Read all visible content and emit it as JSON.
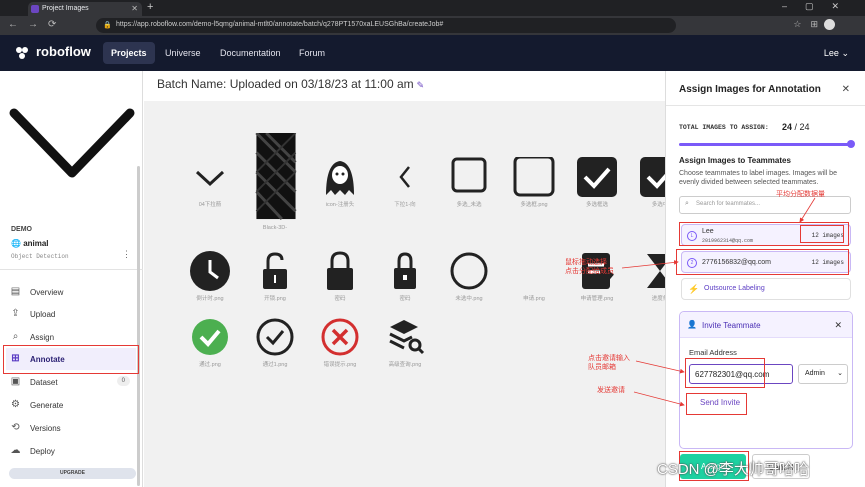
{
  "browser": {
    "tab_title": "Project Images",
    "url": "https://app.roboflow.com/demo-l5qmg/animal-mtlt0/annotate/batch/q278PT1570xaLEUSGhBa/createJob#"
  },
  "topnav": {
    "brand": "roboflow",
    "items": [
      "Projects",
      "Universe",
      "Documentation",
      "Forum"
    ],
    "user": "Lee"
  },
  "sidebar": {
    "workspace": "DEMO",
    "project": "animal",
    "project_type": "Object Detection",
    "menu": [
      {
        "label": "Overview",
        "icon": "overview-icon"
      },
      {
        "label": "Upload",
        "icon": "upload-icon"
      },
      {
        "label": "Assign",
        "icon": "search-icon"
      },
      {
        "label": "Annotate",
        "icon": "annotate-icon"
      },
      {
        "label": "Dataset",
        "icon": "dataset-icon",
        "badge": "0"
      },
      {
        "label": "Generate",
        "icon": "generate-icon"
      },
      {
        "label": "Versions",
        "icon": "versions-icon"
      },
      {
        "label": "Deploy",
        "icon": "deploy-icon"
      }
    ],
    "upgrade": "UPGRADE"
  },
  "main": {
    "batch_name": "Batch Name: Uploaded on 03/18/23 at 11:00 am",
    "images": [
      {
        "caption": "04下拉箭",
        "icon": "chevron-down"
      },
      {
        "caption": "Black-3D-",
        "icon": "dark-texture"
      },
      {
        "caption": "icon-注册头",
        "icon": "ghost"
      },
      {
        "caption": "下拉1-向",
        "icon": "chevron-left"
      },
      {
        "caption": "多选_未选",
        "icon": "square-outline"
      },
      {
        "caption": "多选框.png",
        "icon": "square-outline"
      },
      {
        "caption": "多选框选",
        "icon": "checked-box"
      },
      {
        "caption": "多选中",
        "icon": "checked-box"
      },
      {
        "caption": "倒计时.png",
        "icon": "clock"
      },
      {
        "caption": "开锁.png",
        "icon": "unlock"
      },
      {
        "caption": "密码",
        "icon": "lock"
      },
      {
        "caption": "密码",
        "icon": "lock-key"
      },
      {
        "caption": "未选中.png",
        "icon": "circle-outline"
      },
      {
        "caption": "申请.png",
        "icon": "blank"
      },
      {
        "caption": "申请管理.png",
        "icon": "doc-edit"
      },
      {
        "caption": "进度条",
        "icon": "hourglass"
      },
      {
        "caption": "通过.png",
        "icon": "check-green"
      },
      {
        "caption": "通过1.png",
        "icon": "check-outline"
      },
      {
        "caption": "错误提示.png",
        "icon": "x-red"
      },
      {
        "caption": "高级查询.png",
        "icon": "layers-search"
      }
    ]
  },
  "panel": {
    "title": "Assign Images for Annotation",
    "total_label": "TOTAL IMAGES TO ASSIGN:",
    "total_value": "24",
    "total_of": "/ 24",
    "teammates_title": "Assign Images to Teammates",
    "teammates_desc": "Choose teammates to label images. Images will be evenly divided between selected teammates.",
    "search_placeholder": "Search for teammates...",
    "members": [
      {
        "initial": "L",
        "name": "Lee",
        "email": "2019962314@qq.com",
        "count": "12 images"
      },
      {
        "initial": "2",
        "name": "2776156832@qq.com",
        "count": "12 images"
      }
    ],
    "outsource": "Outsource Labeling",
    "invite": {
      "title": "Invite Teammate",
      "email_label": "Email Address",
      "email_value": "627782301@qq.com",
      "role": "Admin",
      "send": "Send Invite"
    },
    "assign_button": "Assign",
    "cancel_button": "Cancel"
  },
  "annotations": {
    "even_split": "平均分配数据量",
    "drag_select": "鼠标拖动选择",
    "drag_select2": "点击分配给成员",
    "invite_click": "点击邀请输入",
    "invite_click2": "队员邮箱",
    "send_invite": "发送邀请"
  },
  "watermark": "CSDN @李大帅哥哈哈"
}
